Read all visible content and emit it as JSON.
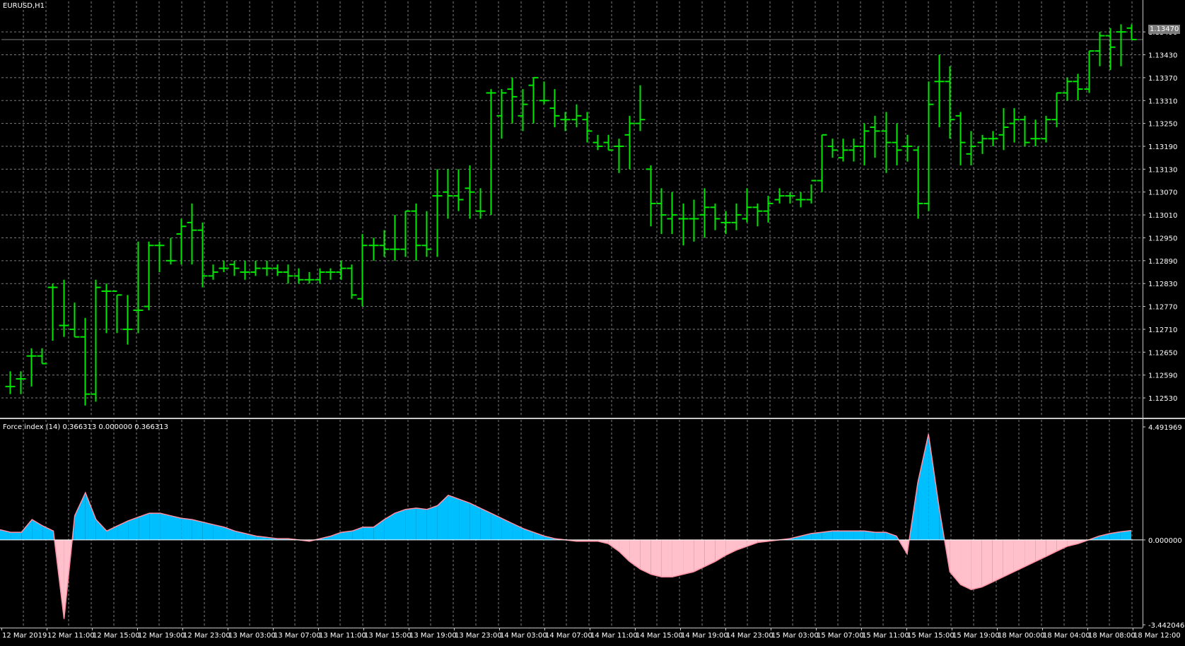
{
  "window": {
    "symbol_label": "EURUSD,H1"
  },
  "colors": {
    "background": "#000000",
    "grid": "#7b7b7b",
    "axis": "#c8c8c8",
    "bars": "#00e600",
    "force_positive_fill": "#00bfff",
    "force_negative_fill": "#ffc0cb",
    "force_upper_line": "#ff8fa3",
    "force_lower_line": "#5aa0ff",
    "price_line": "#7b7b7b"
  },
  "chart_data": [
    {
      "type": "bar",
      "style": "ohlc",
      "name": "EURUSD,H1",
      "grid": true,
      "current_price": 1.1347,
      "current_price_label": "1.13470",
      "y_ticks": [
        "1.13490",
        "1.13430",
        "1.13370",
        "1.13310",
        "1.13250",
        "1.13190",
        "1.13130",
        "1.13070",
        "1.13010",
        "1.12950",
        "1.12890",
        "1.12830",
        "1.12770",
        "1.12710",
        "1.12650",
        "1.12590",
        "1.12530"
      ],
      "ylim": [
        1.1248,
        1.1357
      ],
      "x_labels": [
        "12 Mar 2019",
        "12 Mar 11:00",
        "12 Mar 15:00",
        "12 Mar 19:00",
        "12 Mar 23:00",
        "13 Mar 03:00",
        "13 Mar 07:00",
        "13 Mar 11:00",
        "13 Mar 15:00",
        "13 Mar 19:00",
        "13 Mar 23:00",
        "14 Mar 03:00",
        "14 Mar 07:00",
        "14 Mar 11:00",
        "14 Mar 15:00",
        "14 Mar 19:00",
        "14 Mar 23:00",
        "15 Mar 03:00",
        "15 Mar 07:00",
        "15 Mar 11:00",
        "15 Mar 15:00",
        "15 Mar 19:00",
        "18 Mar 00:00",
        "18 Mar 04:00",
        "18 Mar 08:00",
        "18 Mar 12:00"
      ],
      "ohlc": [
        [
          1.1256,
          1.126,
          1.1254,
          1.1256
        ],
        [
          1.1258,
          1.126,
          1.1254,
          1.1258
        ],
        [
          1.1264,
          1.1266,
          1.1256,
          1.1264
        ],
        [
          1.1264,
          1.1266,
          1.1262,
          1.1262
        ],
        [
          1.1282,
          1.1283,
          1.1268,
          1.1282
        ],
        [
          1.1272,
          1.1284,
          1.1269,
          1.1272
        ],
        [
          1.1271,
          1.1278,
          1.1269,
          1.1269
        ],
        [
          1.1269,
          1.1274,
          1.1251,
          1.1254
        ],
        [
          1.1254,
          1.1284,
          1.1252,
          1.1282
        ],
        [
          1.1281,
          1.1283,
          1.127,
          1.1281
        ],
        [
          1.1281,
          1.128,
          1.127,
          1.128
        ],
        [
          1.1271,
          1.128,
          1.1267,
          1.1271
        ],
        [
          1.1276,
          1.1294,
          1.127,
          1.1276
        ],
        [
          1.1277,
          1.1294,
          1.1276,
          1.1293
        ],
        [
          1.1293,
          1.1294,
          1.1286,
          1.1293
        ],
        [
          1.1289,
          1.1295,
          1.1288,
          1.1289
        ],
        [
          1.1296,
          1.13,
          1.1288,
          1.1298
        ],
        [
          1.1299,
          1.1304,
          1.1288,
          1.1297
        ],
        [
          1.1297,
          1.1299,
          1.1282,
          1.1285
        ],
        [
          1.1285,
          1.1288,
          1.1284,
          1.1286
        ],
        [
          1.1287,
          1.1289,
          1.1286,
          1.1287
        ],
        [
          1.1288,
          1.1289,
          1.1285,
          1.1287
        ],
        [
          1.1286,
          1.1289,
          1.1284,
          1.1286
        ],
        [
          1.1286,
          1.1289,
          1.1285,
          1.1287
        ],
        [
          1.1287,
          1.1289,
          1.1285,
          1.1287
        ],
        [
          1.1287,
          1.1288,
          1.1285,
          1.1286
        ],
        [
          1.1286,
          1.1288,
          1.1283,
          1.1285
        ],
        [
          1.1285,
          1.1287,
          1.1283,
          1.1284
        ],
        [
          1.1284,
          1.1286,
          1.1283,
          1.1284
        ],
        [
          1.1284,
          1.1287,
          1.1283,
          1.1286
        ],
        [
          1.1286,
          1.1287,
          1.1284,
          1.1286
        ],
        [
          1.1286,
          1.1289,
          1.1284,
          1.1287
        ],
        [
          1.1287,
          1.1288,
          1.1279,
          1.128
        ],
        [
          1.1279,
          1.1296,
          1.1277,
          1.1293
        ],
        [
          1.1293,
          1.1295,
          1.1289,
          1.1293
        ],
        [
          1.1293,
          1.1297,
          1.129,
          1.1292
        ],
        [
          1.1292,
          1.1301,
          1.1289,
          1.1292
        ],
        [
          1.1292,
          1.1302,
          1.129,
          1.1302
        ],
        [
          1.1302,
          1.1304,
          1.1289,
          1.1293
        ],
        [
          1.1293,
          1.1302,
          1.129,
          1.1292
        ],
        [
          1.1306,
          1.1313,
          1.129,
          1.1306
        ],
        [
          1.1307,
          1.1313,
          1.13,
          1.1306
        ],
        [
          1.1306,
          1.1313,
          1.1302,
          1.1305
        ],
        [
          1.1308,
          1.1314,
          1.13,
          1.1307
        ],
        [
          1.1302,
          1.1308,
          1.13,
          1.1302
        ],
        [
          1.1333,
          1.1334,
          1.1301,
          1.1333
        ],
        [
          1.1327,
          1.1334,
          1.1321,
          1.1333
        ],
        [
          1.1334,
          1.1337,
          1.1325,
          1.1332
        ],
        [
          1.1327,
          1.1334,
          1.1323,
          1.133
        ],
        [
          1.1335,
          1.1337,
          1.1325,
          1.1337
        ],
        [
          1.1331,
          1.1336,
          1.133,
          1.1331
        ],
        [
          1.1329,
          1.1334,
          1.1324,
          1.1327
        ],
        [
          1.1326,
          1.1328,
          1.1323,
          1.1326
        ],
        [
          1.1326,
          1.133,
          1.1324,
          1.1327
        ],
        [
          1.1326,
          1.1328,
          1.132,
          1.1323
        ],
        [
          1.132,
          1.1322,
          1.1318,
          1.1319
        ],
        [
          1.132,
          1.1322,
          1.1318,
          1.1318
        ],
        [
          1.1319,
          1.1321,
          1.1312,
          1.1319
        ],
        [
          1.1322,
          1.1327,
          1.1313,
          1.1325
        ],
        [
          1.1325,
          1.1335,
          1.1323,
          1.1326
        ],
        [
          1.1313,
          1.1314,
          1.1298,
          1.1304
        ],
        [
          1.1304,
          1.1308,
          1.1296,
          1.1301
        ],
        [
          1.13,
          1.1307,
          1.1296,
          1.1301
        ],
        [
          1.13,
          1.1304,
          1.1293,
          1.13
        ],
        [
          1.13,
          1.1305,
          1.1294,
          1.13
        ],
        [
          1.1301,
          1.1308,
          1.1295,
          1.1303
        ],
        [
          1.1303,
          1.1304,
          1.1297,
          1.13
        ],
        [
          1.1299,
          1.1302,
          1.1296,
          1.1299
        ],
        [
          1.1299,
          1.1304,
          1.1297,
          1.1301
        ],
        [
          1.13,
          1.1308,
          1.1299,
          1.1303
        ],
        [
          1.1303,
          1.1304,
          1.1298,
          1.1302
        ],
        [
          1.1302,
          1.1306,
          1.1299,
          1.1304
        ],
        [
          1.1305,
          1.1308,
          1.1304,
          1.1306
        ],
        [
          1.1306,
          1.1307,
          1.1304,
          1.1306
        ],
        [
          1.1305,
          1.1307,
          1.1303,
          1.1305
        ],
        [
          1.1305,
          1.1309,
          1.1304,
          1.131
        ],
        [
          1.131,
          1.1322,
          1.1307,
          1.1322
        ],
        [
          1.1319,
          1.1321,
          1.1316,
          1.1318
        ],
        [
          1.1316,
          1.1321,
          1.1315,
          1.1318
        ],
        [
          1.1318,
          1.1321,
          1.1315,
          1.1319
        ],
        [
          1.1319,
          1.1325,
          1.1314,
          1.1323
        ],
        [
          1.1324,
          1.1327,
          1.1316,
          1.1323
        ],
        [
          1.1323,
          1.1328,
          1.1312,
          1.132
        ],
        [
          1.132,
          1.1325,
          1.1314,
          1.1318
        ],
        [
          1.1319,
          1.1322,
          1.1315,
          1.1319
        ],
        [
          1.1318,
          1.1319,
          1.13,
          1.1304
        ],
        [
          1.1304,
          1.1336,
          1.1302,
          1.133
        ],
        [
          1.1336,
          1.1343,
          1.1324,
          1.1336
        ],
        [
          1.1336,
          1.134,
          1.1321,
          1.1326
        ],
        [
          1.1327,
          1.1328,
          1.1314,
          1.132
        ],
        [
          1.1317,
          1.1323,
          1.1314,
          1.1319
        ],
        [
          1.132,
          1.1322,
          1.1317,
          1.1321
        ],
        [
          1.1321,
          1.1323,
          1.1319,
          1.1321
        ],
        [
          1.1322,
          1.1329,
          1.1318,
          1.1324
        ],
        [
          1.1325,
          1.1329,
          1.132,
          1.1326
        ],
        [
          1.1326,
          1.1327,
          1.1319,
          1.132
        ],
        [
          1.1321,
          1.1326,
          1.1319,
          1.1321
        ],
        [
          1.1321,
          1.1327,
          1.132,
          1.1326
        ],
        [
          1.1326,
          1.1333,
          1.1324,
          1.1333
        ],
        [
          1.1333,
          1.1337,
          1.1331,
          1.1336
        ],
        [
          1.1336,
          1.1338,
          1.1331,
          1.1334
        ],
        [
          1.1334,
          1.1344,
          1.1333,
          1.1344
        ],
        [
          1.1344,
          1.1349,
          1.134,
          1.1348
        ],
        [
          1.1348,
          1.135,
          1.1339,
          1.1345
        ],
        [
          1.1349,
          1.1351,
          1.134,
          1.1349
        ],
        [
          1.135,
          1.1351,
          1.1347,
          1.1347
        ]
      ]
    },
    {
      "type": "area",
      "name": "Force index (14) 0.366313 0.000000 0.366313",
      "legend_text": "Force index (14) 0.366313 0.000000 0.366313",
      "grid": true,
      "y_ticks": [
        "4.491969",
        "0.000000",
        "-3.442046"
      ],
      "ylim": [
        -3.442046,
        4.491969
      ],
      "values": [
        0.4,
        0.3,
        0.3,
        0.8,
        0.55,
        0.35,
        -3.1,
        0.95,
        1.85,
        0.8,
        0.35,
        0.55,
        0.75,
        0.9,
        1.05,
        1.05,
        0.95,
        0.85,
        0.8,
        0.7,
        0.6,
        0.5,
        0.35,
        0.25,
        0.15,
        0.1,
        0.05,
        0.05,
        0.0,
        -0.05,
        0.05,
        0.15,
        0.3,
        0.35,
        0.5,
        0.5,
        0.8,
        1.05,
        1.2,
        1.25,
        1.2,
        1.35,
        1.75,
        1.6,
        1.45,
        1.25,
        1.05,
        0.85,
        0.65,
        0.45,
        0.3,
        0.15,
        0.05,
        0.0,
        -0.05,
        -0.05,
        -0.05,
        -0.15,
        -0.45,
        -0.85,
        -1.15,
        -1.35,
        -1.45,
        -1.45,
        -1.35,
        -1.25,
        -1.05,
        -0.85,
        -0.6,
        -0.4,
        -0.25,
        -0.1,
        -0.05,
        0.0,
        0.05,
        0.15,
        0.25,
        0.3,
        0.35,
        0.35,
        0.35,
        0.35,
        0.3,
        0.3,
        0.15,
        -0.55,
        2.25,
        4.15,
        1.25,
        -1.25,
        -1.75,
        -1.95,
        -1.85,
        -1.65,
        -1.45,
        -1.25,
        -1.05,
        -0.85,
        -0.65,
        -0.45,
        -0.25,
        -0.15,
        0.0,
        0.15,
        0.25,
        0.32,
        0.37
      ]
    }
  ]
}
